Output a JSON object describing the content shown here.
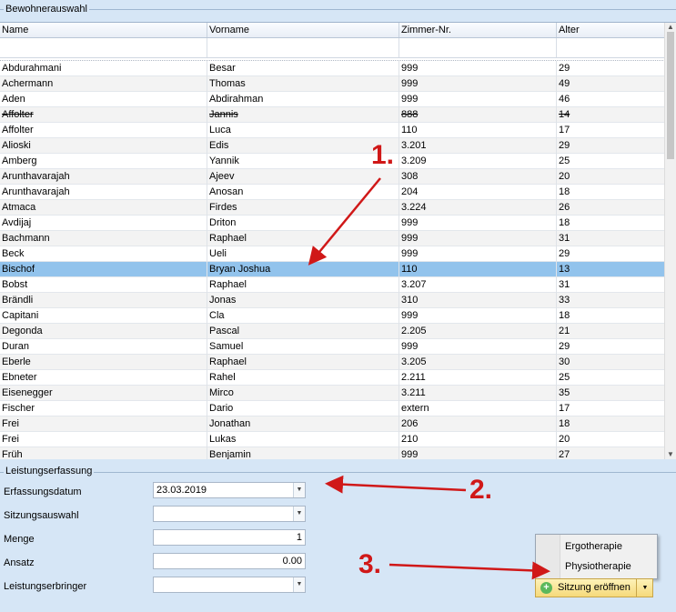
{
  "group_residents": {
    "title": "Bewohnerauswahl"
  },
  "grid": {
    "columns": [
      "Name",
      "Vorname",
      "Zimmer-Nr.",
      "Alter"
    ],
    "rows": [
      [
        "Abdurahmani",
        "Besar",
        "999",
        "29"
      ],
      [
        "Achermann",
        "Thomas",
        "999",
        "49"
      ],
      [
        "Aden",
        "Abdirahman",
        "999",
        "46"
      ],
      [
        "Affolter",
        "Jannis",
        "888",
        "14"
      ],
      [
        "Affolter",
        "Luca",
        "110",
        "17"
      ],
      [
        "Alioski",
        "Edis",
        "3.201",
        "29"
      ],
      [
        "Amberg",
        "Yannik",
        "3.209",
        "25"
      ],
      [
        "Arunthavarajah",
        "Ajeev",
        "308",
        "20"
      ],
      [
        "Arunthavarajah",
        "Anosan",
        "204",
        "18"
      ],
      [
        "Atmaca",
        "Firdes",
        "3.224",
        "26"
      ],
      [
        "Avdijaj",
        "Driton",
        "999",
        "18"
      ],
      [
        "Bachmann",
        "Raphael",
        "999",
        "31"
      ],
      [
        "Beck",
        "Ueli",
        "999",
        "29"
      ],
      [
        "Bischof",
        "Bryan Joshua",
        "110",
        "13"
      ],
      [
        "Bobst",
        "Raphael",
        "3.207",
        "31"
      ],
      [
        "Brändli",
        "Jonas",
        "310",
        "33"
      ],
      [
        "Capitani",
        "Cla",
        "999",
        "18"
      ],
      [
        "Degonda",
        "Pascal",
        "2.205",
        "21"
      ],
      [
        "Duran",
        "Samuel",
        "999",
        "29"
      ],
      [
        "Eberle",
        "Raphael",
        "3.205",
        "30"
      ],
      [
        "Ebneter",
        "Rahel",
        "2.211",
        "25"
      ],
      [
        "Eisenegger",
        "Mirco",
        "3.211",
        "35"
      ],
      [
        "Fischer",
        "Dario",
        "extern",
        "17"
      ],
      [
        "Frei",
        "Jonathan",
        "206",
        "18"
      ],
      [
        "Frei",
        "Lukas",
        "210",
        "20"
      ],
      [
        "Früh",
        "Benjamin",
        "999",
        "27"
      ]
    ],
    "selected_row": "Bischof",
    "struck_row": "Affolter Jannis"
  },
  "group_service": {
    "title": "Leistungserfassung"
  },
  "form": {
    "erfassungsdatum_label": "Erfassungsdatum",
    "erfassungsdatum_value": "23.03.2019",
    "sitzungsauswahl_label": "Sitzungsauswahl",
    "sitzungsauswahl_value": "",
    "menge_label": "Menge",
    "menge_value": "1",
    "ansatz_label": "Ansatz",
    "ansatz_value": "0.00",
    "leistungserbringer_label": "Leistungserbringer",
    "leistungserbringer_value": ""
  },
  "menu": {
    "items": [
      "Ergotherapie",
      "Physiotherapie"
    ]
  },
  "button": {
    "label": "Sitzung eröffnen"
  },
  "annotations": {
    "a1": "1.",
    "a2": "2.",
    "a3": "3."
  },
  "colors": {
    "selection": "#92c3ec",
    "annotation": "#d01818",
    "button": "#f6d97a"
  }
}
